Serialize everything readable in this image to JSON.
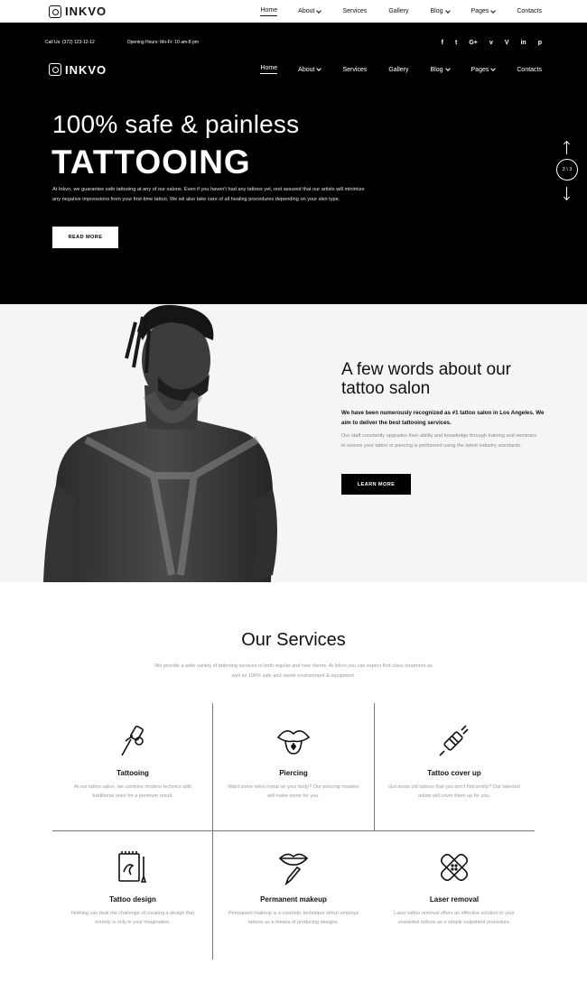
{
  "brand": "INKVO",
  "nav": [
    {
      "label": "Home",
      "active": true,
      "dropdown": false
    },
    {
      "label": "About",
      "active": false,
      "dropdown": true
    },
    {
      "label": "Services",
      "active": false,
      "dropdown": false
    },
    {
      "label": "Gallery",
      "active": false,
      "dropdown": false
    },
    {
      "label": "Blog",
      "active": false,
      "dropdown": true
    },
    {
      "label": "Pages",
      "active": false,
      "dropdown": true
    },
    {
      "label": "Contacts",
      "active": false,
      "dropdown": false
    }
  ],
  "infobar": {
    "call": "Call Us: (372) 123-12-12",
    "hours": "Opening Hours: Mn-Fr: 10 am-8 pm",
    "socials": [
      "f",
      "t",
      "G+",
      "v",
      "V",
      "in",
      "p"
    ]
  },
  "hero": {
    "title_line1": "100% safe & painless",
    "title_line2": "TATTOOING",
    "text": "At Inkvo, we guarantee safe tattooing at any of our salons. Even if you haven't had any tattoos yet, rest assured that our artists will minimize any negative impressions from your first-time tattoo. We wil also take care of all healing procedures depending on your skin type.",
    "button": "READ MORE",
    "slide_counter": "3 \\ 3"
  },
  "about": {
    "title": "A few words about our tattoo salon",
    "lead": "We have been numerously recognized as #1 tattoo salon in Los Angeles. We aim to deliver the best tattooing services.",
    "text": "Our staff constantly upgrades their ability and knowledge through training and seminars to ensure your tattoo or piercing is performed using the latest industry standards.",
    "button": "LEARN MORE"
  },
  "services": {
    "title": "Our Services",
    "subtitle": "We provide a wide variety of tattooing services to both regular and new clients. At Inkvo you can expect first class treatment as well as 100% safe and sterile environment & equipment.",
    "items": [
      {
        "name": "Tattooing",
        "icon": "tattoo-machine-icon",
        "desc": "At our tattoo salon, we combine modern technics with traditional ones for a premium result."
      },
      {
        "name": "Piercing",
        "icon": "tongue-piercing-icon",
        "desc": "Want some extra metal on your body? Our piercing masters will make some for you."
      },
      {
        "name": "Tattoo cover up",
        "icon": "tattoo-pen-icon",
        "desc": "Got some old tattoos that you don't find pretty? Our talented artists will cover them up for you."
      },
      {
        "name": "Tattoo design",
        "icon": "sketchbook-icon",
        "desc": "Nothing can beat the challenge of creating a design that entirely is only in your imagination."
      },
      {
        "name": "Permanent makeup",
        "icon": "lips-brush-icon",
        "desc": "Permanent makeup is a cosmetic technique which employs tattoos as a means of producing designs."
      },
      {
        "name": "Laser removal",
        "icon": "bandage-icon",
        "desc": "Laser tattoo removal offers an effective solution to your unwanted tattoos as a simple outpatient procedure."
      }
    ]
  }
}
